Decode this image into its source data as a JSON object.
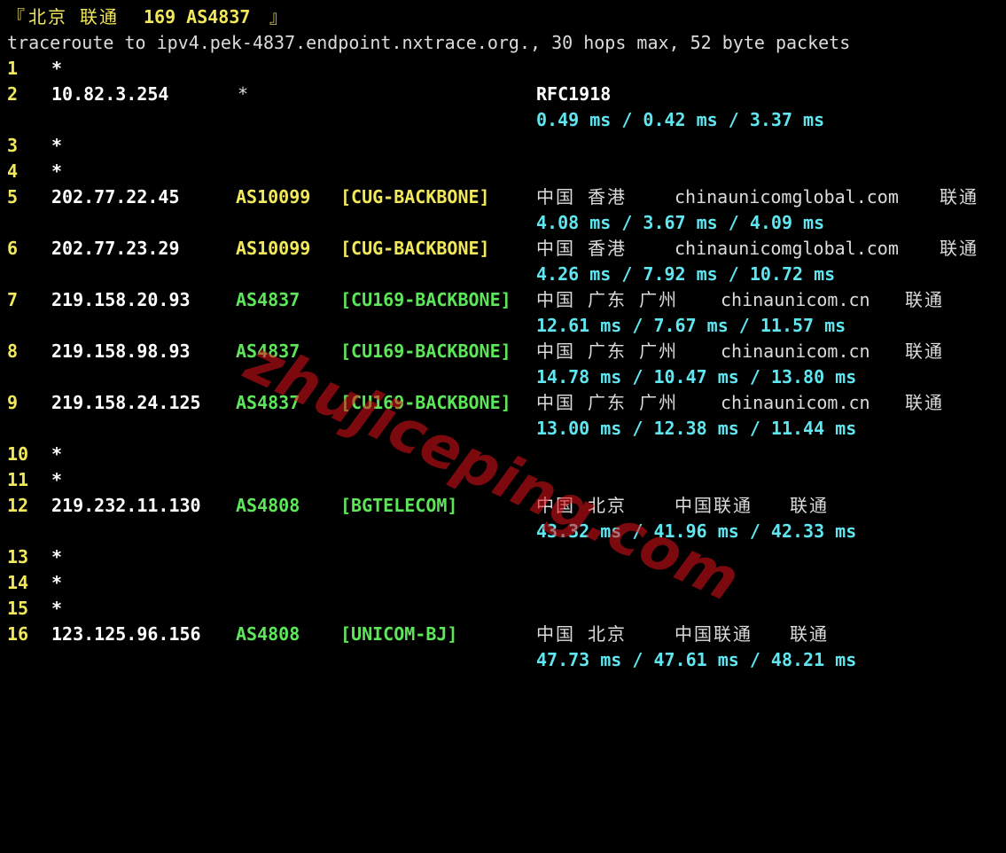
{
  "header": {
    "bracket_open": "『",
    "location": "北京 联通",
    "tag": "169 AS4837",
    "bracket_close": "』"
  },
  "command_line": "traceroute to ipv4.pek-4837.endpoint.nxtrace.org., 30 hops max, 52 byte packets",
  "hops": [
    {
      "num": "1",
      "ip": "*"
    },
    {
      "num": "2",
      "ip": "10.82.3.254",
      "asn": "*",
      "tag": "",
      "geo": "RFC1918",
      "isp": "",
      "carrier": "",
      "rtt": "0.49 ms / 0.42 ms / 3.37 ms"
    },
    {
      "num": "3",
      "ip": "*"
    },
    {
      "num": "4",
      "ip": "*"
    },
    {
      "num": "5",
      "ip": "202.77.22.45",
      "asn": "AS10099",
      "tag": "[CUG-BACKBONE]",
      "geo": "中国 香港",
      "isp": "chinaunicomglobal.com",
      "carrier": "联通",
      "rtt": "4.08 ms / 3.67 ms / 4.09 ms"
    },
    {
      "num": "6",
      "ip": "202.77.23.29",
      "asn": "AS10099",
      "tag": "[CUG-BACKBONE]",
      "geo": "中国 香港",
      "isp": "chinaunicomglobal.com",
      "carrier": "联通",
      "rtt": "4.26 ms / 7.92 ms / 10.72 ms"
    },
    {
      "num": "7",
      "ip": "219.158.20.93",
      "asn": "AS4837",
      "tag": "[CU169-BACKBONE]",
      "geo": "中国 广东 广州",
      "isp": "chinaunicom.cn",
      "carrier": "联通",
      "rtt": "12.61 ms / 7.67 ms / 11.57 ms"
    },
    {
      "num": "8",
      "ip": "219.158.98.93",
      "asn": "AS4837",
      "tag": "[CU169-BACKBONE]",
      "geo": "中国 广东 广州",
      "isp": "chinaunicom.cn",
      "carrier": "联通",
      "rtt": "14.78 ms / 10.47 ms / 13.80 ms"
    },
    {
      "num": "9",
      "ip": "219.158.24.125",
      "asn": "AS4837",
      "tag": "[CU169-BACKBONE]",
      "geo": "中国 广东 广州",
      "isp": "chinaunicom.cn",
      "carrier": "联通",
      "rtt": "13.00 ms / 12.38 ms / 11.44 ms"
    },
    {
      "num": "10",
      "ip": "*"
    },
    {
      "num": "11",
      "ip": "*"
    },
    {
      "num": "12",
      "ip": "219.232.11.130",
      "asn": "AS4808",
      "tag": "[BGTELECOM]",
      "geo": "中国 北京",
      "isp": "中国联通",
      "carrier": "联通",
      "rtt": "43.32 ms / 41.96 ms / 42.33 ms"
    },
    {
      "num": "13",
      "ip": "*"
    },
    {
      "num": "14",
      "ip": "*"
    },
    {
      "num": "15",
      "ip": "*"
    },
    {
      "num": "16",
      "ip": "123.125.96.156",
      "asn": "AS4808",
      "tag": "[UNICOM-BJ]",
      "geo": "中国 北京",
      "isp": "中国联通",
      "carrier": "联通",
      "rtt": "47.73 ms / 47.61 ms / 48.21 ms"
    }
  ],
  "watermark": "zhujiceping.com",
  "colors": {
    "background": "#000000",
    "hop_number": "#f2e85c",
    "ip": "#ffffff",
    "asn_cug": "#f2e85c",
    "asn_cu": "#5ee65a",
    "rtt": "#5fe6f0",
    "geo": "#dcdcdc",
    "watermark": "#e0121b"
  }
}
